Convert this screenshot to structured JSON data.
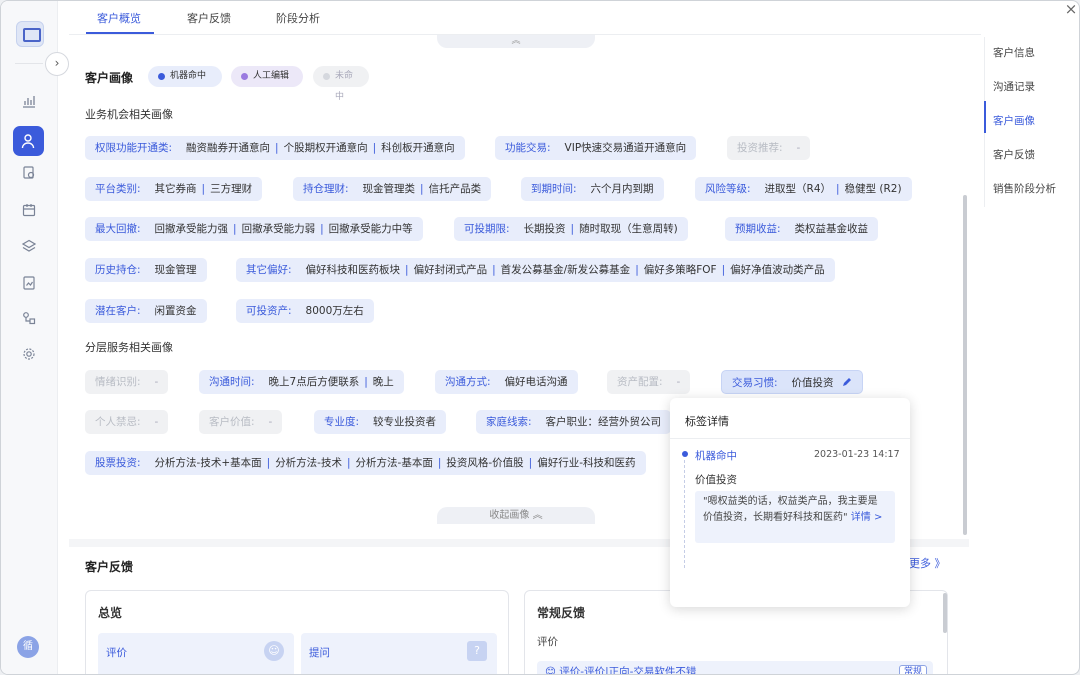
{
  "tabs": [
    "客户概览",
    "客户反馈",
    "阶段分析"
  ],
  "portrait": {
    "title": "客户画像",
    "legend": [
      {
        "label": "机器命中",
        "color": "#3b5bdb",
        "bg": "#e8edfb",
        "text": "#333"
      },
      {
        "label": "人工编辑",
        "color": "#9a7ae0",
        "bg": "#ece8f8",
        "text": "#333"
      },
      {
        "label": "未命中",
        "color": "#d5d8de",
        "bg": "#f0f1f3",
        "text": "#aab"
      }
    ],
    "business_title": "业务机会相关画像",
    "service_title": "分层服务相关画像",
    "collapse_label": "收起画像 ︽",
    "expand_icon": "︽"
  },
  "chips": [
    {
      "k": "权限功能开通类:",
      "v": [
        "融资融券开通意向",
        "个股期权开通意向",
        "科创板开通意向"
      ]
    },
    {
      "k": "功能交易:",
      "v": [
        "VIP快速交易通道开通意向"
      ]
    },
    {
      "k": "投资推荐:",
      "v": [
        "-"
      ],
      "dis": true
    },
    {
      "k": "平台类别:",
      "v": [
        "其它券商",
        "三方理财"
      ]
    },
    {
      "k": "持仓理财:",
      "v": [
        "现金管理类",
        "信托产品类"
      ]
    },
    {
      "k": "到期时间:",
      "v": [
        "六个月内到期"
      ]
    },
    {
      "k": "风险等级:",
      "v": [
        "进取型（R4）",
        "稳健型 (R2)"
      ]
    },
    {
      "k": "最大回撤:",
      "v": [
        "回撤承受能力强",
        "回撤承受能力弱",
        "回撤承受能力中等"
      ]
    },
    {
      "k": "可投期限:",
      "v": [
        "长期投资",
        "随时取现（生意周转)"
      ]
    },
    {
      "k": "预期收益:",
      "v": [
        "类权益基金收益"
      ]
    },
    {
      "k": "历史持仓:",
      "v": [
        "现金管理"
      ]
    },
    {
      "k": "其它偏好:",
      "v": [
        "偏好科技和医药板块",
        "偏好封闭式产品",
        "首发公募基金/新发公募基金",
        "偏好多策略FOF",
        "偏好净值波动类产品"
      ]
    },
    {
      "k": "潜在客户:",
      "v": [
        "闲置资金"
      ]
    },
    {
      "k": "可投资产:",
      "v": [
        "8000万左右"
      ]
    },
    {
      "k": "情绪识别:",
      "v": [
        "-"
      ],
      "dis": true
    },
    {
      "k": "沟通时间:",
      "v": [
        "晚上7点后方便联系",
        "晚上"
      ]
    },
    {
      "k": "沟通方式:",
      "v": [
        "偏好电话沟通"
      ]
    },
    {
      "k": "资产配置:",
      "v": [
        "-"
      ],
      "dis": true
    },
    {
      "k": "交易习惯:",
      "v": [
        "价值投资"
      ],
      "edit": true
    },
    {
      "k": "个人禁忌:",
      "v": [
        "-"
      ],
      "dis": true
    },
    {
      "k": "客户价值:",
      "v": [
        "-"
      ],
      "dis": true
    },
    {
      "k": "专业度:",
      "v": [
        "较专业投资者"
      ]
    },
    {
      "k": "家庭线索:",
      "v": [
        "客户职业：经营外贸公司"
      ]
    },
    {
      "k": "股票投资:",
      "v": [
        "分析方法-技术+基本面",
        "分析方法-技术",
        "分析方法-基本面",
        "投资风格-价值股",
        "偏好行业-科技和医药"
      ]
    }
  ],
  "feedback": {
    "title": "客户反馈",
    "more": "更多 》",
    "overview": {
      "title": "总览",
      "items": [
        "评价",
        "提问"
      ]
    },
    "regular": {
      "title": "常规反馈",
      "sub": "评价",
      "item": "😊 评价-评价|正向-交易软件不错",
      "tag": "常规"
    }
  },
  "right_nav": [
    "客户信息",
    "沟通记录",
    "客户画像",
    "客户反馈",
    "销售阶段分析"
  ],
  "popover": {
    "title": "标签详情",
    "source": "机器命中",
    "time": "2023-01-23 14:17",
    "value": "价值投资",
    "quote": "\"嗯权益类的话，权益类产品，我主要是价值投资，长期看好科技和医药\"",
    "detail": "详情 >"
  },
  "user_initial": "循",
  "close_icon": "×"
}
